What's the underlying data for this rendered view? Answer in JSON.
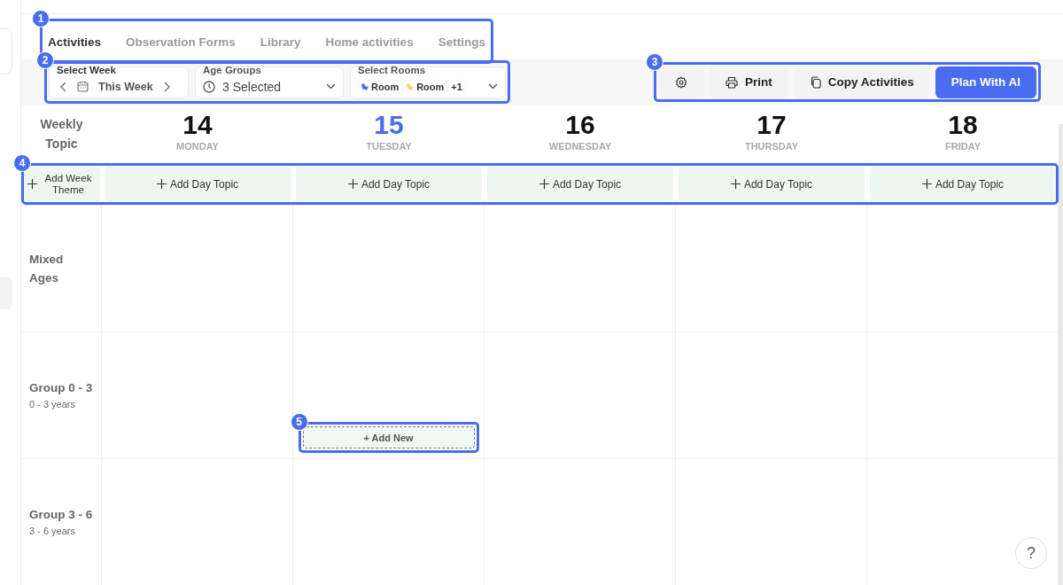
{
  "tabs": {
    "callout": "1",
    "items": [
      {
        "label": "Activities",
        "selected": true
      },
      {
        "label": "Observation Forms",
        "selected": false
      },
      {
        "label": "Library",
        "selected": false
      },
      {
        "label": "Home activities",
        "selected": false
      },
      {
        "label": "Settings",
        "selected": false
      }
    ]
  },
  "filters": {
    "callout": "2",
    "week": {
      "label": "Select Week",
      "value": "This Week"
    },
    "age_groups": {
      "label": "Age Groups",
      "value": "3 Selected"
    },
    "rooms": {
      "label": "Select Rooms",
      "chips": [
        {
          "label": "Room",
          "color": "#4a6cf0"
        },
        {
          "label": "Room",
          "color": "#f2d56b"
        }
      ],
      "more": "+1"
    }
  },
  "actions": {
    "callout": "3",
    "print": "Print",
    "copy": "Copy Activities",
    "plan": "Plan With AI"
  },
  "calendar": {
    "corner": "Weekly Topic",
    "days": [
      {
        "number": "14",
        "name": "MONDAY",
        "selected": false
      },
      {
        "number": "15",
        "name": "TUESDAY",
        "selected": true
      },
      {
        "number": "16",
        "name": "WEDNESDAY",
        "selected": false
      },
      {
        "number": "17",
        "name": "THURSDAY",
        "selected": false
      },
      {
        "number": "18",
        "name": "FRIDAY",
        "selected": false
      }
    ],
    "topic_row": {
      "callout": "4",
      "week_theme": "Add Week Theme",
      "day_topics": [
        "Add Day Topic",
        "Add Day Topic",
        "Add Day Topic",
        "Add Day Topic",
        "Add Day Topic"
      ]
    },
    "rows": [
      {
        "title": "Mixed Ages",
        "cells": [
          {
            "kind": "empty"
          },
          {
            "kind": "empty"
          },
          {
            "kind": "empty"
          },
          {
            "kind": "empty"
          },
          {
            "kind": "empty"
          }
        ]
      },
      {
        "title": "Group 0 - 3",
        "subtitle": "0 - 3 years",
        "cells": [
          {
            "kind": "empty"
          },
          {
            "kind": "add",
            "label": "+ Add New",
            "callout": "5"
          },
          {
            "kind": "empty"
          },
          {
            "kind": "empty"
          },
          {
            "kind": "empty"
          }
        ]
      },
      {
        "title": "Group 3 - 6",
        "subtitle": "3 - 6 years",
        "cells": [
          {
            "kind": "empty"
          },
          {
            "kind": "empty"
          },
          {
            "kind": "empty"
          },
          {
            "kind": "empty"
          },
          {
            "kind": "empty"
          }
        ]
      }
    ]
  },
  "help": "?"
}
